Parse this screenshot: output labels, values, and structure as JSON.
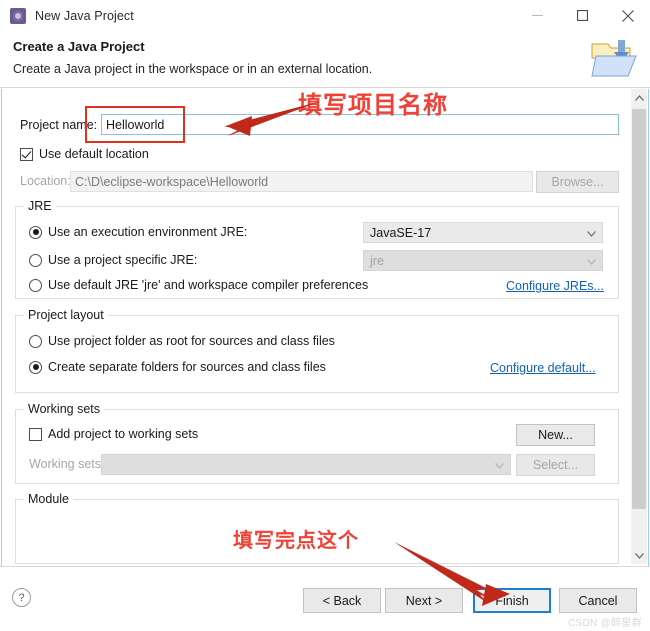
{
  "window": {
    "title": "New Java Project",
    "icon": "eclipse-java-icon",
    "controls": {
      "minimize": "minimize-icon",
      "maximize": "maximize-icon",
      "close": "close-icon"
    }
  },
  "header": {
    "title": "Create a Java Project",
    "description": "Create a Java project in the workspace or in an external location.",
    "icon": "new-java-project-folder-icon"
  },
  "form": {
    "project_name_label": "Project name:",
    "project_name_value": "Helloworld",
    "project_name_placeholder": "",
    "use_default_location_label": "Use default location",
    "use_default_location_checked": true,
    "location_label": "Location:",
    "location_value": "C:\\D\\eclipse-workspace\\Helloworld",
    "browse_button": "Browse..."
  },
  "jre": {
    "group_title": "JRE",
    "options": [
      {
        "label": "Use an execution environment JRE:",
        "selected": true
      },
      {
        "label": "Use a project specific JRE:",
        "selected": false
      },
      {
        "label": "Use default JRE 'jre' and workspace compiler preferences",
        "selected": false
      }
    ],
    "execution_env_value": "JavaSE-17",
    "project_jre_value": "jre",
    "configure_link": "Configure JREs..."
  },
  "project_layout": {
    "group_title": "Project layout",
    "options": [
      {
        "label": "Use project folder as root for sources and class files",
        "selected": false
      },
      {
        "label": "Create separate folders for sources and class files",
        "selected": true
      }
    ],
    "configure_link": "Configure default..."
  },
  "working_sets": {
    "group_title": "Working sets",
    "add_checkbox_label": "Add project to working sets",
    "add_checkbox_checked": false,
    "working_sets_label": "Working sets:",
    "working_sets_value": "",
    "new_button": "New...",
    "select_button": "Select..."
  },
  "module": {
    "group_title": "Module"
  },
  "footer": {
    "help": "?",
    "back_button": "< Back",
    "next_button": "Next >",
    "finish_button": "Finish",
    "cancel_button": "Cancel",
    "watermark": "CSDN @醉星群"
  },
  "annotations": {
    "project_name_note": "填写项目名称",
    "finish_note": "填写完点这个",
    "color": "#ef4136",
    "box_color": "#e0301e"
  },
  "scrollbar": {
    "up_arrow": "chevron-up-icon",
    "down_arrow": "chevron-down-icon"
  },
  "colors": {
    "accent_blue": "#1a7fd4",
    "link_blue": "#1362b5",
    "field_border": "#8ebfd8",
    "panel_border": "#9fd2e8"
  }
}
